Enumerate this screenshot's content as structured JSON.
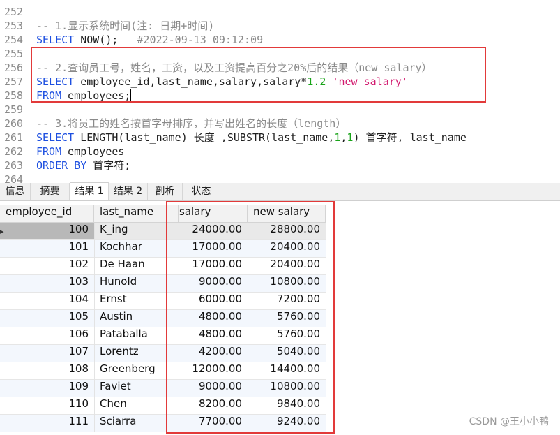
{
  "editor": {
    "lines": [
      {
        "no": "252",
        "parts": []
      },
      {
        "no": "253",
        "parts": [
          {
            "t": "cm",
            "v": "-- 1.显示系统时间(注: 日期+时间)"
          }
        ]
      },
      {
        "no": "254",
        "parts": [
          {
            "t": "kw",
            "v": "SELECT"
          },
          {
            "t": "",
            "v": " NOW();   "
          },
          {
            "t": "cm",
            "v": "#2022-09-13 09:12:09"
          }
        ]
      },
      {
        "no": "255",
        "parts": []
      },
      {
        "no": "256",
        "parts": [
          {
            "t": "cm",
            "v": "-- 2.查询员工号，姓名，工资，以及工资提高百分之20%后的结果（new salary）"
          }
        ]
      },
      {
        "no": "257",
        "parts": [
          {
            "t": "kw",
            "v": "SELECT"
          },
          {
            "t": "",
            "v": " employee_id,last_name,salary,salary*"
          },
          {
            "t": "num",
            "v": "1.2"
          },
          {
            "t": "",
            "v": " "
          },
          {
            "t": "str",
            "v": "'new salary'"
          }
        ]
      },
      {
        "no": "258",
        "parts": [
          {
            "t": "kw",
            "v": "FROM"
          },
          {
            "t": "",
            "v": " employees;"
          }
        ],
        "caret": true
      },
      {
        "no": "259",
        "parts": []
      },
      {
        "no": "260",
        "parts": [
          {
            "t": "cm",
            "v": "-- 3.将员工的姓名按首字母排序，并写出姓名的长度（length）"
          }
        ]
      },
      {
        "no": "261",
        "parts": [
          {
            "t": "kw",
            "v": "SELECT"
          },
          {
            "t": "",
            "v": " LENGTH(last_name) 长度 ,SUBSTR(last_name,"
          },
          {
            "t": "num",
            "v": "1"
          },
          {
            "t": "",
            "v": ","
          },
          {
            "t": "num",
            "v": "1"
          },
          {
            "t": "",
            "v": ") 首字符, last_name"
          }
        ]
      },
      {
        "no": "262",
        "parts": [
          {
            "t": "kw",
            "v": "FROM"
          },
          {
            "t": "",
            "v": " employees"
          }
        ]
      },
      {
        "no": "263",
        "parts": [
          {
            "t": "kw",
            "v": "ORDER BY"
          },
          {
            "t": "",
            "v": " 首字符;"
          }
        ]
      },
      {
        "no": "264",
        "parts": []
      }
    ]
  },
  "tabs": [
    {
      "label": "信息",
      "active": false
    },
    {
      "label": "摘要",
      "active": false
    },
    {
      "label": "结果 1",
      "active": true
    },
    {
      "label": "结果 2",
      "active": false
    },
    {
      "label": "剖析",
      "active": false
    },
    {
      "label": "状态",
      "active": false
    }
  ],
  "grid": {
    "columns": [
      "employee_id",
      "last_name",
      "salary",
      "new salary"
    ],
    "rows": [
      [
        "100",
        "K_ing",
        "24000.00",
        "28800.00"
      ],
      [
        "101",
        "Kochhar",
        "17000.00",
        "20400.00"
      ],
      [
        "102",
        "De Haan",
        "17000.00",
        "20400.00"
      ],
      [
        "103",
        "Hunold",
        "9000.00",
        "10800.00"
      ],
      [
        "104",
        "Ernst",
        "6000.00",
        "7200.00"
      ],
      [
        "105",
        "Austin",
        "4800.00",
        "5760.00"
      ],
      [
        "106",
        "Pataballa",
        "4800.00",
        "5760.00"
      ],
      [
        "107",
        "Lorentz",
        "4200.00",
        "5040.00"
      ],
      [
        "108",
        "Greenberg",
        "12000.00",
        "14400.00"
      ],
      [
        "109",
        "Faviet",
        "9000.00",
        "10800.00"
      ],
      [
        "110",
        "Chen",
        "8200.00",
        "9840.00"
      ],
      [
        "111",
        "Sciarra",
        "7700.00",
        "9240.00"
      ]
    ],
    "selected_row": 0
  },
  "watermark": "CSDN @王小小鸭",
  "colors": {
    "highlight_box": "#e23a3a",
    "keyword": "#1d4fe0",
    "comment": "#8a8a8a",
    "number": "#18a318",
    "string": "#d21b6f"
  }
}
